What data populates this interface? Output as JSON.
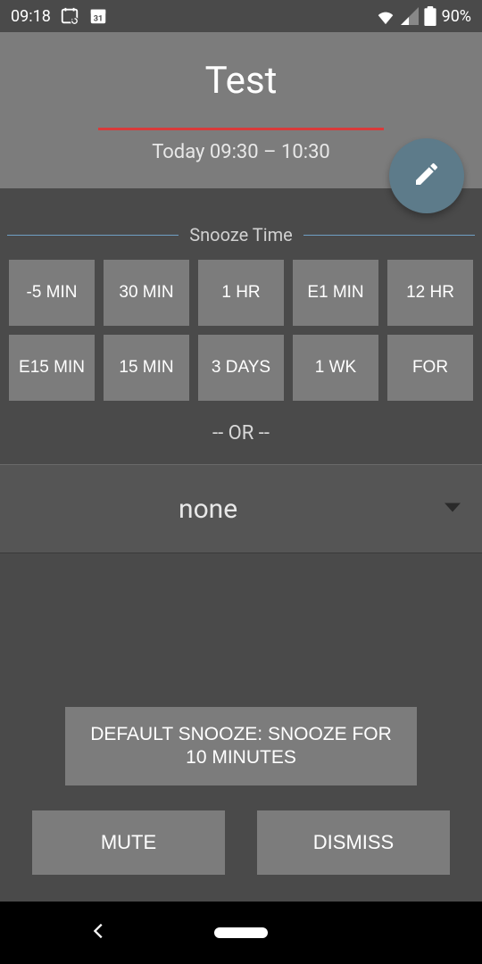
{
  "status": {
    "time": "09:18",
    "battery": "90%"
  },
  "header": {
    "title": "Test",
    "subtitle": "Today  09:30 – 10:30"
  },
  "section": {
    "title": "Snooze Time"
  },
  "snooze_buttons": [
    "-5 MIN",
    "30 MIN",
    "1 HR",
    "E1 MIN",
    "12 HR",
    "E15 MIN",
    "15 MIN",
    "3 DAYS",
    "1 WK",
    "FOR"
  ],
  "or_label": "-- OR --",
  "dropdown": {
    "selected": "none"
  },
  "default_snooze": "DEFAULT SNOOZE:  SNOOZE FOR 10 MINUTES",
  "actions": {
    "mute": "MUTE",
    "dismiss": "DISMISS"
  }
}
